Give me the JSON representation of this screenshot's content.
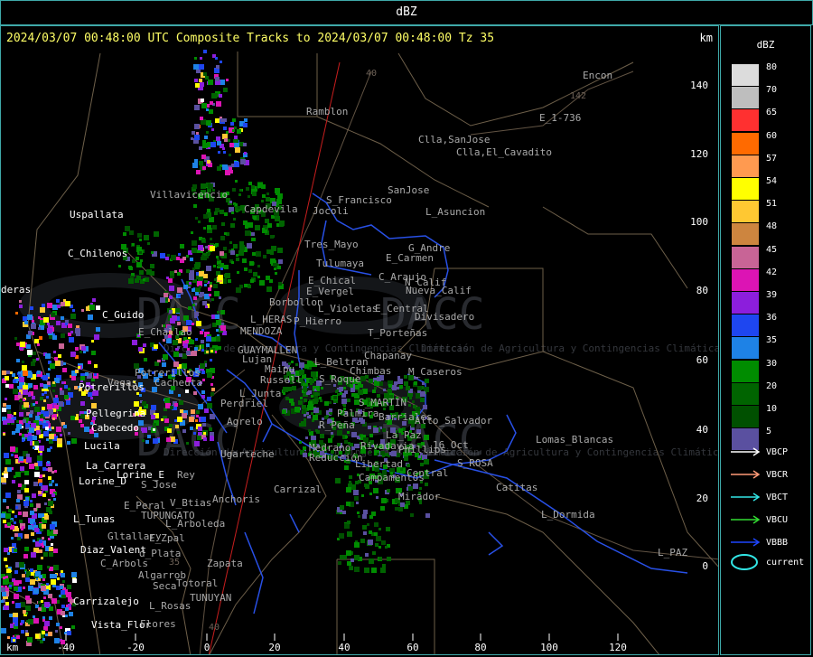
{
  "window": {
    "title": "dBZ"
  },
  "map": {
    "header": "2024/03/07 00:48:00 UTC Composite Tracks to 2024/03/07 00:48:00 Tz 35",
    "km_unit_top": "km",
    "km_unit_bottom": "km",
    "x_ticks": [
      "-40",
      "-20",
      "0",
      "20",
      "40",
      "60",
      "80",
      "100",
      "120"
    ],
    "y_ticks": [
      "140",
      "120",
      "100",
      "80",
      "60",
      "40",
      "20",
      "0"
    ],
    "watermark": {
      "text": "DACC",
      "subtitle": "Dirección de Agricultura y Contingencias Climáticas"
    },
    "place_labels_white": [
      {
        "name": "Uspallata"
      },
      {
        "name": "C_Chilenos"
      },
      {
        "name": "deras"
      },
      {
        "name": "C_Guido"
      },
      {
        "name": "Potrerillos"
      },
      {
        "name": "Pellegrina"
      },
      {
        "name": "Cabecedo"
      },
      {
        "name": "Lucila"
      },
      {
        "name": "La_Carrera"
      },
      {
        "name": "Lorine_E"
      },
      {
        "name": "Lorine_D"
      },
      {
        "name": "L_Tunas"
      },
      {
        "name": "Diaz_Valent"
      },
      {
        "name": "Carrizalejo"
      },
      {
        "name": "Vista_Flor"
      }
    ],
    "place_labels_gray": [
      {
        "name": "Ramblon"
      },
      {
        "name": "Encon"
      },
      {
        "name": "E_1-736"
      },
      {
        "name": "Clla,SanJose"
      },
      {
        "name": "Clla,El_Cavadito"
      },
      {
        "name": "SanJose"
      },
      {
        "name": "S_Francisco"
      },
      {
        "name": "Jocoli"
      },
      {
        "name": "L_Asuncion"
      },
      {
        "name": "Villavicencio"
      },
      {
        "name": "Capdevila"
      },
      {
        "name": "Tres_Mayo"
      },
      {
        "name": "G_Andre"
      },
      {
        "name": "Tulumaya"
      },
      {
        "name": "E_Carmen"
      },
      {
        "name": "E_Chical"
      },
      {
        "name": "C_Araujo"
      },
      {
        "name": "E_Vergel"
      },
      {
        "name": "N_Calif"
      },
      {
        "name": "Borbollon"
      },
      {
        "name": "L_Violetas"
      },
      {
        "name": "E_Central"
      },
      {
        "name": "Divisadero"
      },
      {
        "name": "P_Hierro"
      },
      {
        "name": "E_Challao"
      },
      {
        "name": "T_Porteñas"
      },
      {
        "name": "Chapanay"
      },
      {
        "name": "L_Beltran"
      },
      {
        "name": "Chimbas"
      },
      {
        "name": "M_Caseros"
      },
      {
        "name": "Potrerillos"
      },
      {
        "name": "Vegas"
      },
      {
        "name": "Cacheuta"
      },
      {
        "name": "S_Roque"
      },
      {
        "name": "MENDOZA"
      },
      {
        "name": "Perdriel"
      },
      {
        "name": "Agrelo"
      },
      {
        "name": "R_Peña"
      },
      {
        "name": "Medrano"
      },
      {
        "name": "Reducción"
      },
      {
        "name": "Rivadavia"
      },
      {
        "name": "Phillips"
      },
      {
        "name": "Lomas_Blancas"
      },
      {
        "name": "Ugarteche"
      },
      {
        "name": "Libertad"
      },
      {
        "name": "Central"
      },
      {
        "name": "S_ROSA"
      },
      {
        "name": "Campamentos"
      },
      {
        "name": "Carrizal"
      },
      {
        "name": "Anchoris"
      },
      {
        "name": "Catitas"
      },
      {
        "name": "Mirador"
      },
      {
        "name": "L_Dormida"
      },
      {
        "name": "E_Peral"
      },
      {
        "name": "V_Btias"
      },
      {
        "name": "TUPUNGATO"
      },
      {
        "name": "L_Arboleda"
      },
      {
        "name": "Gltallary"
      },
      {
        "name": "E_Zpal"
      },
      {
        "name": "d_Plata"
      },
      {
        "name": "C_Arbols"
      },
      {
        "name": "Zapata"
      },
      {
        "name": "Algarrob"
      },
      {
        "name": "Seca"
      },
      {
        "name": "Totoral"
      },
      {
        "name": "L_Rosas"
      },
      {
        "name": "TUNUYAN"
      },
      {
        "name": "Flores"
      },
      {
        "name": "L_PAZ"
      },
      {
        "name": "Maipu"
      },
      {
        "name": "Lujan"
      },
      {
        "name": "Russell"
      },
      {
        "name": "L_Junta"
      },
      {
        "name": "S_Jose"
      },
      {
        "name": "Rey"
      },
      {
        "name": "L_HERAS"
      },
      {
        "name": "GUAYMALLEN"
      },
      {
        "name": "S_MARTIN"
      },
      {
        "name": "Palmira"
      },
      {
        "name": "Barriales"
      },
      {
        "name": "Alto_Salvador"
      },
      {
        "name": "Nueva_Calif"
      },
      {
        "name": "16_Oct"
      },
      {
        "name": "La_Paz"
      }
    ],
    "road_numbers": [
      "40",
      "142",
      "35",
      "40"
    ]
  },
  "legend": {
    "title": "dBZ",
    "levels": [
      {
        "value": "80",
        "color": "#dcdcdc"
      },
      {
        "value": "70",
        "color": "#bebebe"
      },
      {
        "value": "65",
        "color": "#ff3030"
      },
      {
        "value": "60",
        "color": "#ff6a00"
      },
      {
        "value": "57",
        "color": "#ff9a50"
      },
      {
        "value": "54",
        "color": "#ffff00"
      },
      {
        "value": "51",
        "color": "#ffc832"
      },
      {
        "value": "48",
        "color": "#cd853f"
      },
      {
        "value": "45",
        "color": "#c86496"
      },
      {
        "value": "42",
        "color": "#dc14b4"
      },
      {
        "value": "39",
        "color": "#8c1edc"
      },
      {
        "value": "36",
        "color": "#1e46f0"
      },
      {
        "value": "35",
        "color": "#1e82e6"
      },
      {
        "value": "30",
        "color": "#008c00"
      },
      {
        "value": "20",
        "color": "#006400"
      },
      {
        "value": "10",
        "color": "#005000"
      },
      {
        "value": "5",
        "color": "#5a50a0"
      }
    ],
    "tracks": [
      {
        "label": "VBCP",
        "color": "#ffffff"
      },
      {
        "label": "VBCR",
        "color": "#ff9a78"
      },
      {
        "label": "VBCT",
        "color": "#32e6e6"
      },
      {
        "label": "VBCU",
        "color": "#32dc32"
      },
      {
        "label": "VBBB",
        "color": "#1e46ff"
      }
    ],
    "current": {
      "label": "current",
      "color": "#32e6e6"
    }
  }
}
